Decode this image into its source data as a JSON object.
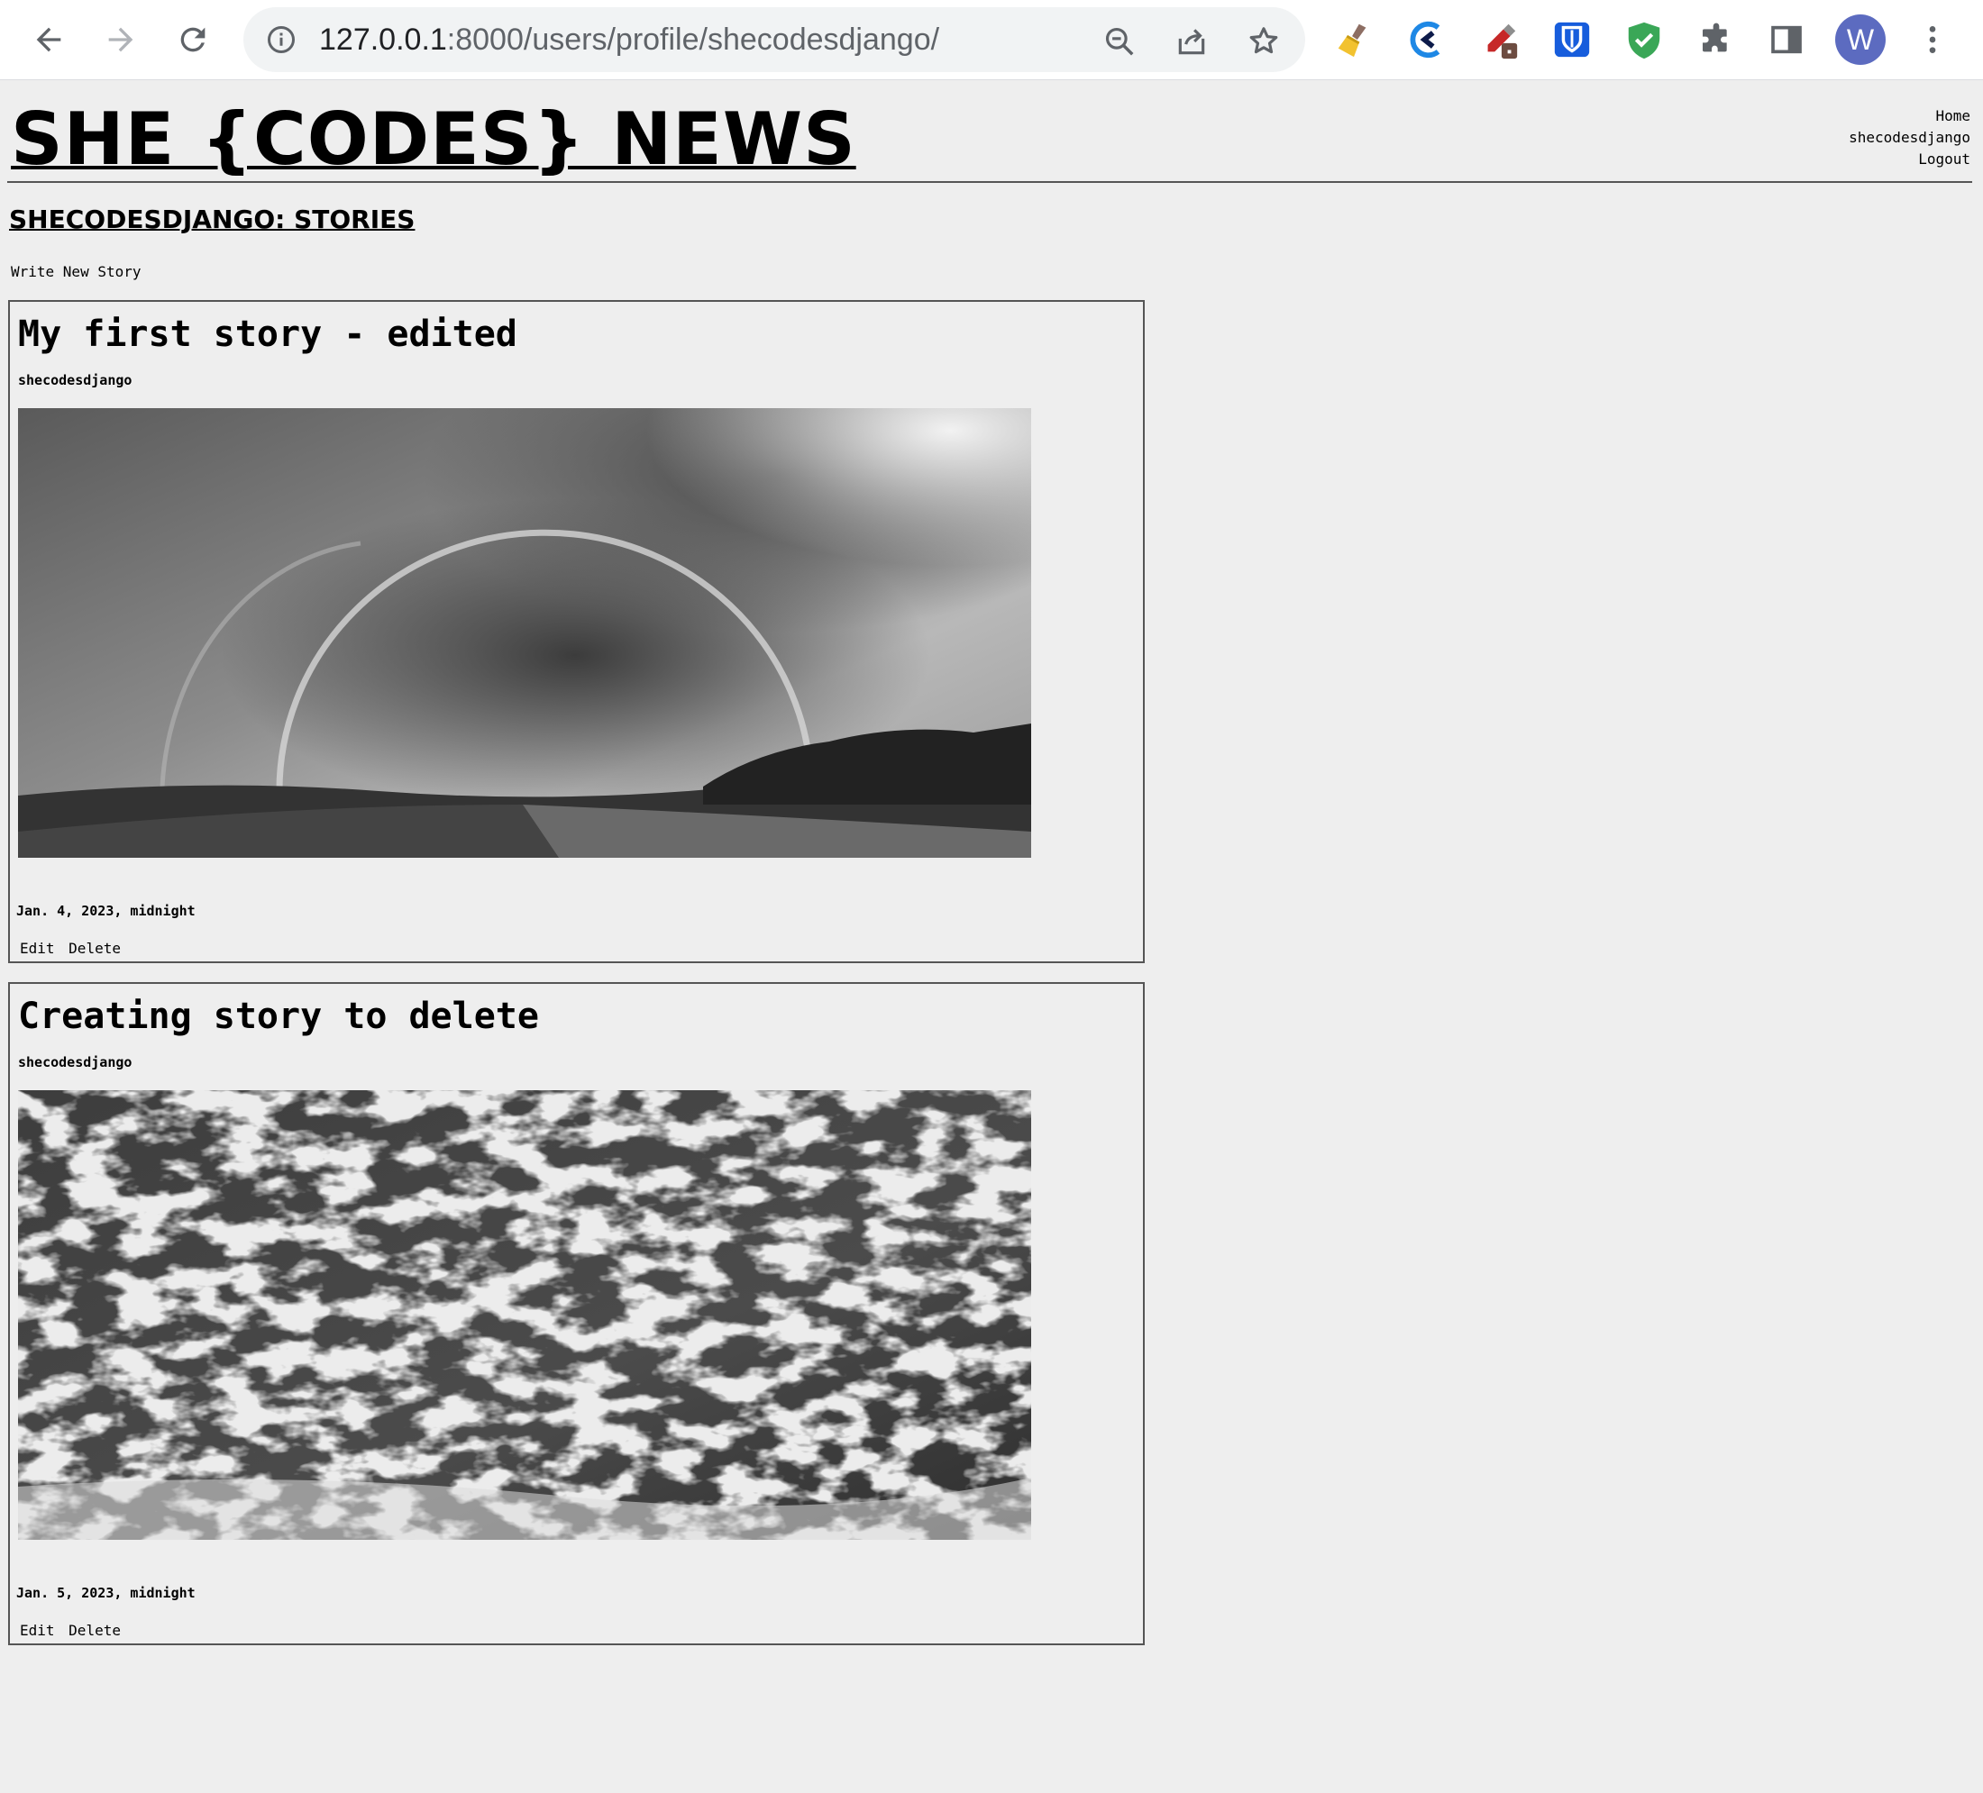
{
  "browser": {
    "url_host": "127.0.0.1",
    "url_rest": ":8000/users/profile/shecodesdjango/",
    "avatar_letter": "W",
    "icons": [
      "back-icon",
      "forward-icon",
      "reload-icon",
      "site-info-icon",
      "zoom-out-icon",
      "share-icon",
      "bookmark-star-icon",
      "broom-extension-icon",
      "arc-extension-icon",
      "eyedropper-extension-icon",
      "bitwarden-extension-icon",
      "shield-extension-icon",
      "extensions-puzzle-icon",
      "side-panel-icon",
      "kebab-menu-icon"
    ]
  },
  "site": {
    "title": "SHE {CODES} NEWS",
    "nav": {
      "home": "Home",
      "username": "shecodesdjango",
      "logout": "Logout"
    }
  },
  "profile": {
    "heading": "SHECODESDJANGO: STORIES",
    "write_new": "Write New Story"
  },
  "stories": [
    {
      "title": "My first story - edited",
      "author": "shecodesdjango",
      "image": "rainbow-landscape-image",
      "date": "Jan. 4, 2023, midnight",
      "edit": "Edit",
      "delete": "Delete"
    },
    {
      "title": "Creating story to delete",
      "author": "shecodesdjango",
      "image": "ocean-waves-image",
      "date": "Jan. 5, 2023, midnight",
      "edit": "Edit",
      "delete": "Delete"
    }
  ],
  "colors": {
    "page_bg": "#eeeeee",
    "avatar": "#5c6bc0",
    "bitwarden": "#175ddc",
    "shield": "#3aa757"
  }
}
